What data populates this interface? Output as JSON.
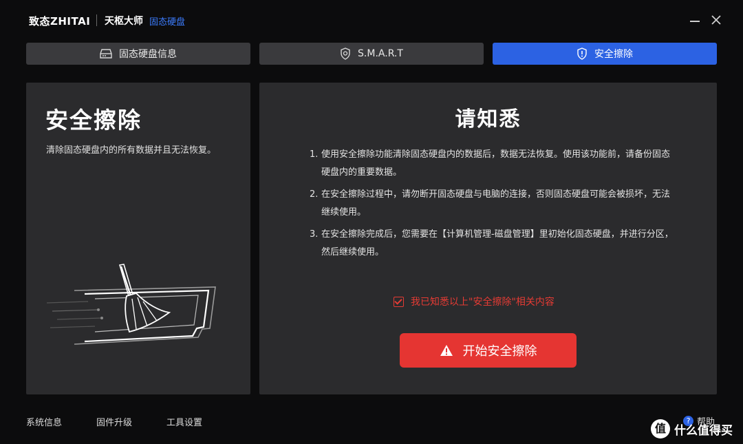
{
  "app": {
    "brand": "致态ZHITAI",
    "product": "天枢大师",
    "subtitle": "固态硬盘"
  },
  "window_controls": {
    "minimize": "minimize",
    "close": "close"
  },
  "tabs": [
    {
      "label": "固态硬盘信息",
      "icon": "drive-icon",
      "active": false
    },
    {
      "label": "S.M.A.R.T",
      "icon": "shield-badge-icon",
      "active": false
    },
    {
      "label": "安全擦除",
      "icon": "shield-alert-icon",
      "active": true
    }
  ],
  "left_panel": {
    "title": "安全擦除",
    "description": "清除固态硬盘内的所有数据并且无法恢复。"
  },
  "notice": {
    "title": "请知悉",
    "items": [
      {
        "num": "1.",
        "text": "使用安全擦除功能清除固态硬盘内的数据后，数据无法恢复。使用该功能前，请备份固态硬盘内的重要数据。"
      },
      {
        "num": "2.",
        "text": "在安全擦除过程中，请勿断开固态硬盘与电脑的连接，否则固态硬盘可能会被损坏，无法继续使用。"
      },
      {
        "num": "3.",
        "text": "在安全擦除完成后，您需要在【计算机管理-磁盘管理】里初始化固态硬盘，并进行分区，然后继续使用。"
      }
    ],
    "confirm_label": "我已知悉以上\"安全擦除\"相关内容",
    "confirm_checked": true,
    "start_button": "开始安全擦除"
  },
  "footer": {
    "links": [
      "系统信息",
      "固件升级",
      "工具设置"
    ],
    "help": "帮助"
  },
  "watermark": {
    "logo": "值",
    "text": "什么值得买"
  },
  "colors": {
    "accent": "#2c62e3",
    "danger": "#e53532",
    "panel": "#2b2b2d",
    "background": "#0c0c0d"
  }
}
